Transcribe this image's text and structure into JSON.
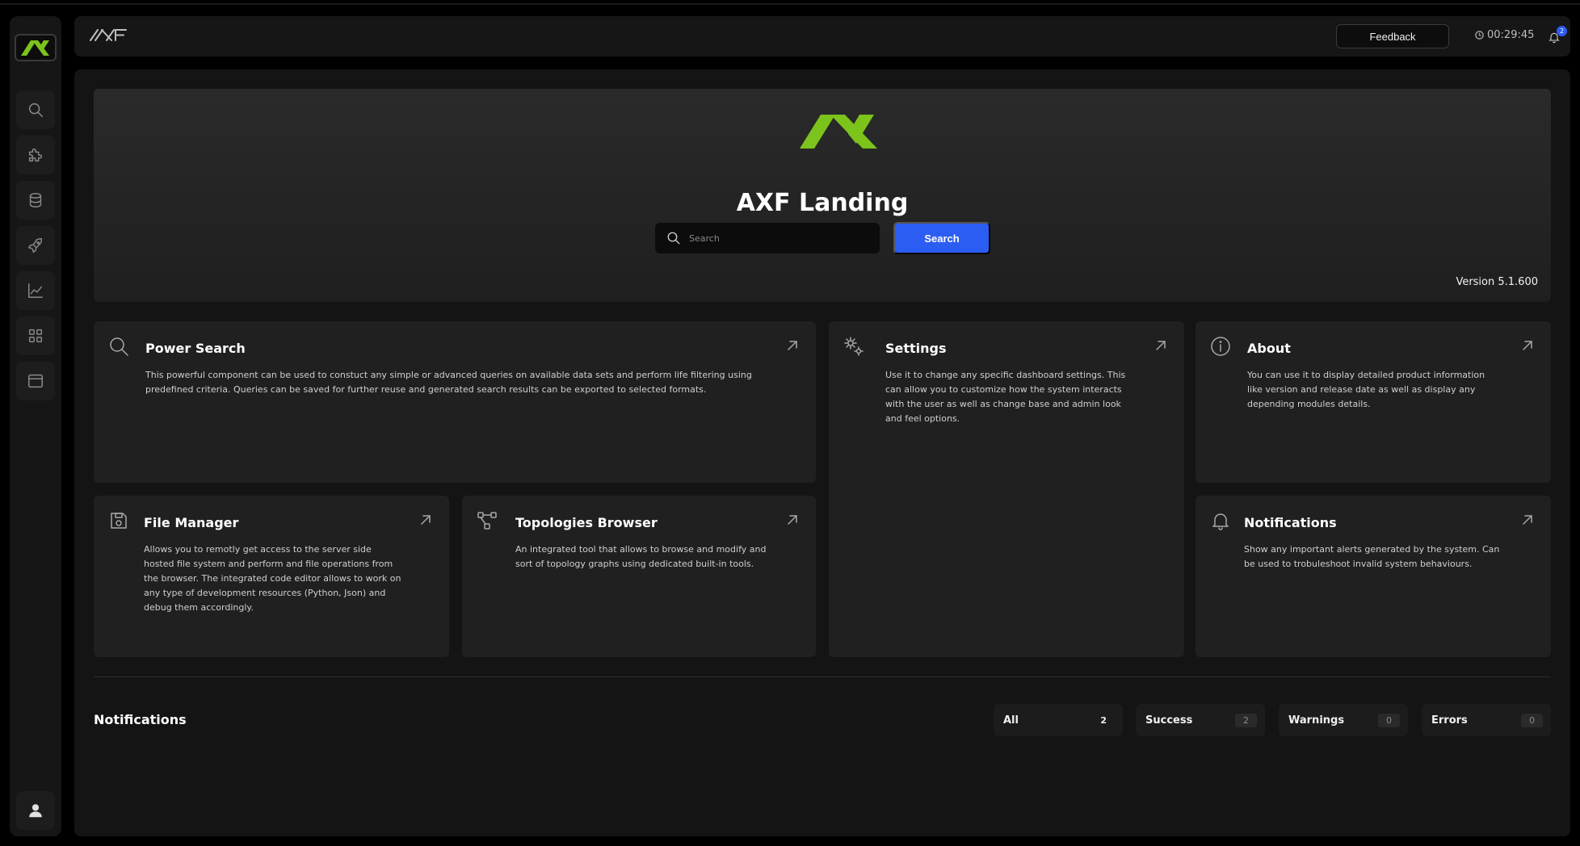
{
  "app": {
    "brand": "AXF",
    "accent_color": "#7cc31b",
    "primary_button_color": "#2c5df2"
  },
  "sidebar": {
    "items": [
      {
        "icon": "search-icon",
        "name": "sidebar-item-search"
      },
      {
        "icon": "puzzle-icon",
        "name": "sidebar-item-plugins"
      },
      {
        "icon": "database-icon",
        "name": "sidebar-item-database"
      },
      {
        "icon": "rocket-icon",
        "name": "sidebar-item-deploy"
      },
      {
        "icon": "chart-line-icon",
        "name": "sidebar-item-analytics"
      },
      {
        "icon": "grid-icon",
        "name": "sidebar-item-apps"
      },
      {
        "icon": "window-icon",
        "name": "sidebar-item-browser"
      }
    ],
    "user_icon": "user-icon"
  },
  "topbar": {
    "feedback_label": "Feedback",
    "timer": "00:29:45",
    "notification_count": "2"
  },
  "hero": {
    "title": "AXF Landing",
    "search_placeholder": "Search",
    "search_button": "Search",
    "version": "Version 5.1.600"
  },
  "cards": {
    "power_search": {
      "title": "Power Search",
      "description": "This powerful component can be used to constuct any simple or advanced queries on available data sets and perform life filtering using predefined criteria. Queries can be saved for further reuse and generated search results can be exported to selected formats."
    },
    "settings": {
      "title": "Settings",
      "description": "Use it to change any specific dashboard settings. This can allow you to customize how the system interacts with the user as well as change base and admin look and feel options."
    },
    "about": {
      "title": "About",
      "description": "You can use it to display detailed product information like version and release date as well as display any depending modules details."
    },
    "file_manager": {
      "title": "File Manager",
      "description": "Allows you to remotly get access to the server side hosted file system and perform and file operations from the browser. The integrated code editor allows to work on any type of development resources (Python, Json) and debug them accordingly."
    },
    "topologies_browser": {
      "title": "Topologies Browser",
      "description": "An integrated tool that allows to browse and modify and sort of topology graphs using dedicated built-in tools."
    },
    "notifications": {
      "title": "Notifications",
      "description": "Show any important alerts generated by the system. Can be used to trobuleshoot invalid system behaviours."
    }
  },
  "notifications": {
    "heading": "Notifications",
    "filters": [
      {
        "label": "All",
        "count": "2"
      },
      {
        "label": "Success",
        "count": "2"
      },
      {
        "label": "Warnings",
        "count": "0"
      },
      {
        "label": "Errors",
        "count": "0"
      }
    ]
  }
}
